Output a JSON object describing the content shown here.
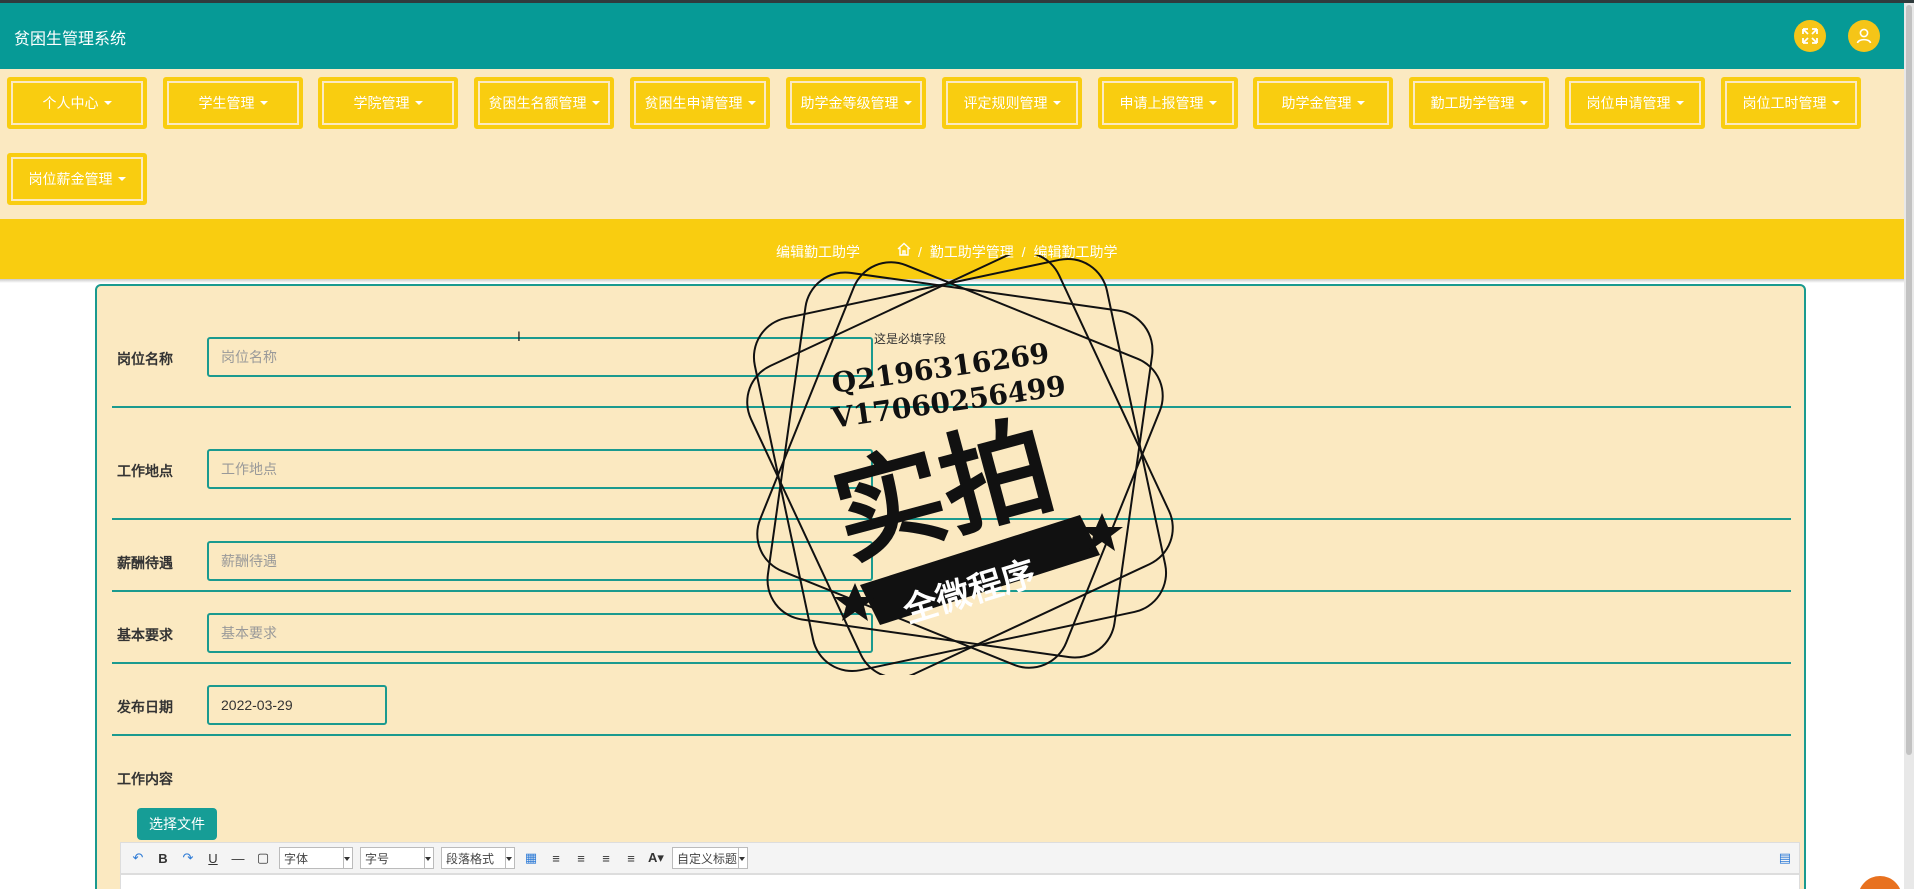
{
  "app": {
    "title": "贫困生管理系统"
  },
  "header": {
    "fullscreen_icon": "fullscreen-icon",
    "user_icon": "user-icon",
    "accent_color": "#f5c518",
    "bar_color": "#069a96"
  },
  "nav": {
    "items": [
      {
        "label": "个人中心"
      },
      {
        "label": "学生管理"
      },
      {
        "label": "学院管理"
      },
      {
        "label": "贫困生名额管理"
      },
      {
        "label": "贫困生申请管理"
      },
      {
        "label": "助学金等级管理"
      },
      {
        "label": "评定规则管理"
      },
      {
        "label": "申请上报管理"
      },
      {
        "label": "助学金管理"
      },
      {
        "label": "勤工助学管理"
      },
      {
        "label": "岗位申请管理"
      },
      {
        "label": "岗位工时管理"
      },
      {
        "label": "岗位薪金管理"
      }
    ]
  },
  "breadcrumb": {
    "title": "编辑勤工助学",
    "separator": "/",
    "items": [
      "勤工助学管理",
      "编辑勤工助学"
    ]
  },
  "form": {
    "fields": [
      {
        "label": "岗位名称",
        "value": "",
        "placeholder": "岗位名称"
      },
      {
        "label": "工作地点",
        "value": "",
        "placeholder": "工作地点"
      },
      {
        "label": "薪酬待遇",
        "value": "",
        "placeholder": "薪酬待遇"
      },
      {
        "label": "基本要求",
        "value": "",
        "placeholder": "基本要求"
      },
      {
        "label": "发布日期",
        "value": "2022-03-29",
        "placeholder": ""
      }
    ],
    "hints": [
      "这是必填字段"
    ],
    "content_label": "工作内容",
    "file_button": "选择文件"
  },
  "editor": {
    "font_select": "字体",
    "size_select": "字号",
    "paragraph_select": "段落格式",
    "title_select": "自定义标题"
  },
  "watermark": {
    "line1": "Q2196316269",
    "line2": "V17060256499",
    "big_text": "实拍",
    "banner": "全微程序"
  }
}
